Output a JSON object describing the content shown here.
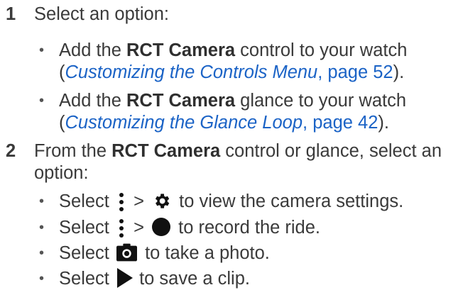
{
  "steps": [
    {
      "number": "1",
      "text": "Select an option:",
      "bullets": [
        {
          "prefix": "Add the ",
          "bold": "RCT Camera",
          "middle": " control to your watch",
          "open_paren": "(",
          "link": "Customizing the Controls Menu",
          "link_page": ", page 52",
          "close": ")."
        },
        {
          "prefix": "Add the ",
          "bold": "RCT Camera",
          "middle": " glance to your watch",
          "open_paren": "(",
          "link": "Customizing the Glance Loop",
          "link_page": ", page 42",
          "close": ")."
        }
      ]
    },
    {
      "number": "2",
      "text_prefix": "From the ",
      "text_bold": "RCT Camera",
      "text_suffix_line1": " control or glance, select an",
      "text_line2": "option:",
      "bullets": [
        {
          "select": "Select",
          "sep": ">",
          "text": "to view the camera settings.",
          "icons": [
            "menu-icon",
            "gear-icon"
          ]
        },
        {
          "select": "Select",
          "sep": ">",
          "text": "to record the ride.",
          "icons": [
            "menu-icon",
            "record-icon"
          ]
        },
        {
          "select": "Select",
          "text": "to take a photo.",
          "icons": [
            "camera-icon"
          ]
        },
        {
          "select": "Select",
          "text": "to save a clip.",
          "icons": [
            "play-icon"
          ]
        }
      ]
    }
  ],
  "colors": {
    "text": "#3a3a3a",
    "link": "#1b63c6",
    "icon": "#111111"
  }
}
